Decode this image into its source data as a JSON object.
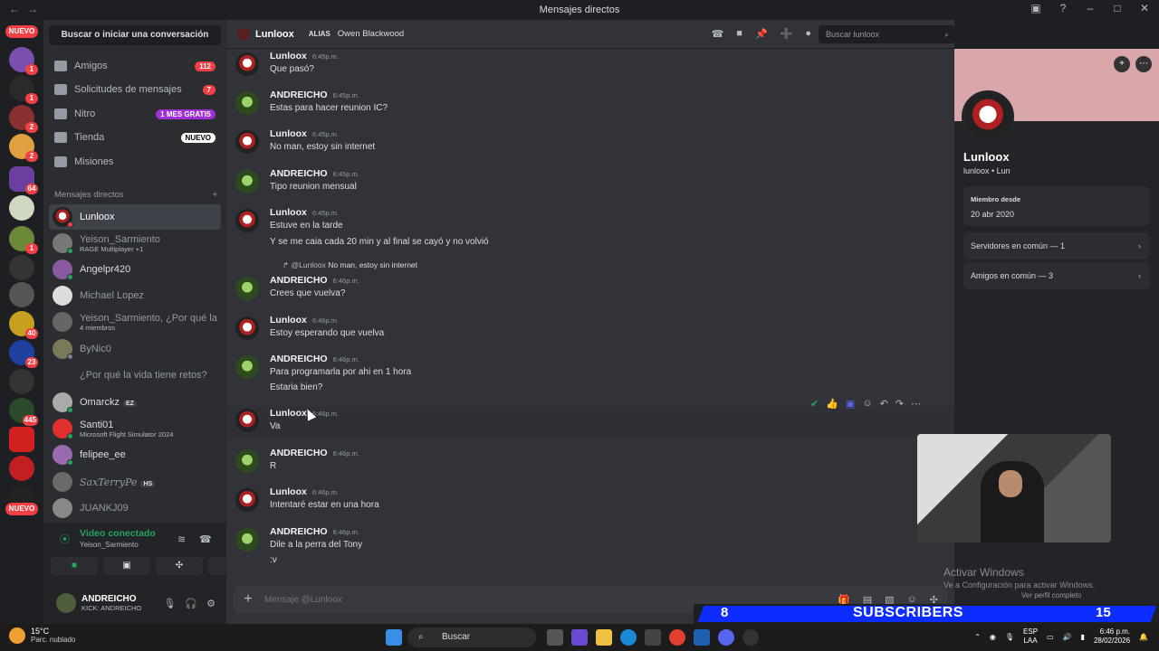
{
  "window": {
    "title": "Mensajes directos"
  },
  "servers": {
    "top_badge": "NUEVO",
    "bottom_badge": "NUEVO",
    "badges": [
      "1",
      "1",
      "2",
      "2",
      "64",
      "1",
      "40",
      "23",
      "445"
    ]
  },
  "sidebar": {
    "search_label": "Buscar o iniciar una conversación",
    "nav": [
      {
        "label": "Amigos",
        "badge": "112"
      },
      {
        "label": "Solicitudes de mensajes",
        "badge": "7"
      },
      {
        "label": "Nitro",
        "badge": "1 MES GRATIS"
      },
      {
        "label": "Tienda",
        "badge": "NUEVO"
      },
      {
        "label": "Misiones",
        "badge": ""
      }
    ],
    "dm_header": "Mensajes directos",
    "dm_add": "+",
    "dms": [
      {
        "name": "Lunloox",
        "sub": ""
      },
      {
        "name": "Yeison_Sarmiento",
        "sub": "RAGE Multiplayer +1"
      },
      {
        "name": "Angelpr420",
        "sub": ""
      },
      {
        "name": "Michael Lopez",
        "sub": ""
      },
      {
        "name": "Yeison_Sarmiento, ¿Por qué la ...",
        "sub": "4 miembros"
      },
      {
        "name": "ByNic0",
        "sub": ""
      },
      {
        "name": "¿Por qué la vida tiene retos?",
        "sub": ""
      },
      {
        "name": "Omarckz",
        "sub": "",
        "tag": "EZ"
      },
      {
        "name": "Santi01",
        "sub": "Microsoft Flight Simulator 2024"
      },
      {
        "name": "felipee_ee",
        "sub": ""
      },
      {
        "name": "SaxTerryPe",
        "sub": "",
        "tag": "HS"
      },
      {
        "name": "JUANKJ09",
        "sub": ""
      }
    ]
  },
  "voice": {
    "status": "Video conectado",
    "channel": "Yeison_Sarmiento"
  },
  "user": {
    "name": "ANDREICHO",
    "status": "KICK: ANDREICHO"
  },
  "chat": {
    "header": {
      "name": "Lunloox",
      "alias_label": "ALIAS",
      "alias": "Owen Blackwood",
      "search_placeholder": "Buscar lunloox"
    },
    "messages": [
      {
        "author": "Lunloox",
        "time": "6:45p.m.",
        "lines": [
          "Que pasó?"
        ]
      },
      {
        "author": "ANDREICHO",
        "time": "6:45p.m.",
        "lines": [
          "Estas para hacer reunion IC?"
        ]
      },
      {
        "author": "Lunloox",
        "time": "6:45p.m.",
        "lines": [
          "No man, estoy sin internet"
        ]
      },
      {
        "author": "ANDREICHO",
        "time": "6:45p.m.",
        "lines": [
          "Tipo reunion mensual"
        ]
      },
      {
        "author": "Lunloox",
        "time": "6:45p.m.",
        "lines": [
          "Estuve en la tarde",
          "Y se me caia cada 20 min y al final se cayó y no volvió"
        ]
      },
      {
        "author": "ANDREICHO",
        "time": "6:46p.m.",
        "lines": [
          "Crees que vuelva?"
        ]
      },
      {
        "author": "Lunloox",
        "time": "6:46p.m.",
        "lines": [
          "Estoy esperando que vuelva"
        ]
      },
      {
        "author": "ANDREICHO",
        "time": "6:46p.m.",
        "lines": [
          "Para programarla por ahi en 1 hora",
          "Estaria bien?"
        ]
      },
      {
        "author": "Lunloox",
        "time": "6:46p.m.",
        "lines": [
          "Va"
        ]
      },
      {
        "author": "ANDREICHO",
        "time": "6:46p.m.",
        "lines": [
          "R"
        ]
      },
      {
        "author": "Lunloox",
        "time": "6:46p.m.",
        "lines": [
          "Intentaré estar en una hora"
        ]
      },
      {
        "author": "ANDREICHO",
        "time": "6:46p.m.",
        "lines": [
          "Dile a la perra del Tony",
          ":v"
        ]
      }
    ],
    "reply": {
      "mention": "@Lunloox",
      "text": "No man, estoy sin internet"
    },
    "composer_placeholder": "Mensaje @Lunloox"
  },
  "profile": {
    "name": "Lunloox",
    "username": "lunloox • Lun",
    "member_since_label": "Miembro desde",
    "member_since": "20 abr 2020",
    "servers_common": "Servidores en común — 1",
    "friends_common": "Amigos en común — 3",
    "view_full": "Ver perfil completo"
  },
  "overlay": {
    "activate_title": "Activar Windows",
    "activate_sub": "Ve a Configuración para activar Windows.",
    "sub_left": "8",
    "sub_label": "SUBSCRIBERS",
    "sub_right": "15"
  },
  "taskbar": {
    "weather_temp": "15°C",
    "weather_desc": "Parc. nublado",
    "search": "Buscar",
    "lang1": "ESP",
    "lang2": "LAA",
    "time": "6:46 p.m.",
    "date": "28/02/2026"
  }
}
